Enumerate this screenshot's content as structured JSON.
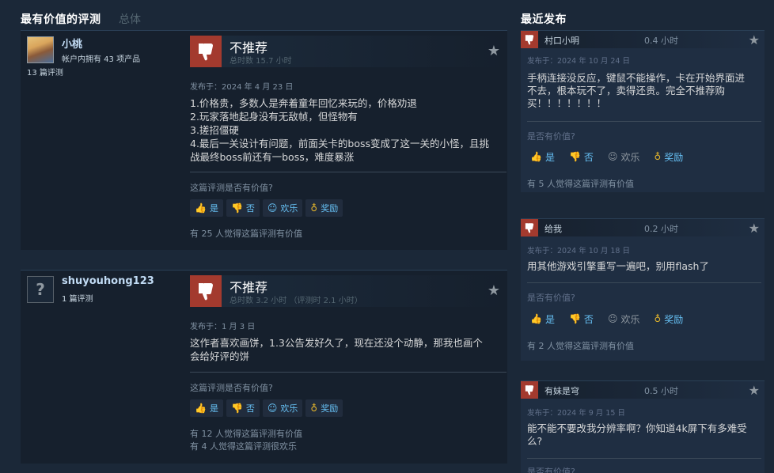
{
  "header": {
    "most_helpful": "最有价值的评测",
    "overall_tab": "总体",
    "recent": "最近发布"
  },
  "ui": {
    "was_helpful": "这篇评测是否有价值?",
    "yes": "是",
    "no": "否",
    "funny": "欢乐",
    "award": "奖励",
    "recent_was_helpful": "是否有价值?"
  },
  "reviews": [
    {
      "persona": "小桃",
      "owned": "帐户内拥有 43 项产品",
      "review_count": "13 篇评测",
      "verdict": "不推荐",
      "hours": "总时数 15.7 小时",
      "posted": "发布于：2024 年 4 月 23 日",
      "lines": [
        "1.价格贵，多数人是奔着童年回忆来玩的，价格劝退",
        "2.玩家落地起身没有无敌帧，但怪物有",
        "3.搓招僵硬",
        "4.最后一关设计有问题，前面关卡的boss变成了这一关的小怪，且挑",
        "战最终boss前还有一boss，难度暴涨"
      ],
      "helpful": [
        "有 25 人觉得这篇评测有价值"
      ]
    },
    {
      "persona": "shuyouhong123",
      "review_count": "1 篇评测",
      "avatar_glyph": "?",
      "verdict": "不推荐",
      "hours": "总时数 3.2 小时 （评测时 2.1 小时）",
      "posted": "发布于：1 月 3 日",
      "lines": [
        "这作者喜欢画饼，1.3公告发好久了，现在还没个动静，那我也画个",
        "会给好评的饼"
      ],
      "helpful": [
        "有 12 人觉得这篇评测有价值",
        "有 4 人觉得这篇评测很欢乐"
      ]
    }
  ],
  "recent": [
    {
      "name": "村口小明",
      "hours": "0.4 小时",
      "posted": "发布于：2024 年 10 月 24 日",
      "lines": [
        "手柄连接没反应，键鼠不能操作，卡在开始界面进",
        "不去，根本玩不了，卖得还贵。完全不推荐购",
        "买！！！！！！！"
      ],
      "helpful": "有 5 人觉得这篇评测有价值"
    },
    {
      "name": "给我",
      "hours": "0.2 小时",
      "posted": "发布于：2024 年 10 月 18 日",
      "lines": [
        "用其他游戏引擎重写一遍吧，别用flash了"
      ],
      "helpful": "有 2 人觉得这篇评测有价值"
    },
    {
      "name": "有妹是穹",
      "hours": "0.5 小时",
      "posted": "发布于：2024 年 9 月 15 日",
      "lines": [
        "能不能不要改我分辨率啊？你知道4k屏下有多难受",
        "么?"
      ]
    }
  ],
  "colors": {
    "thumb_down": "#a33a2e",
    "link": "#66c0f4",
    "award": "#e5b62b"
  }
}
